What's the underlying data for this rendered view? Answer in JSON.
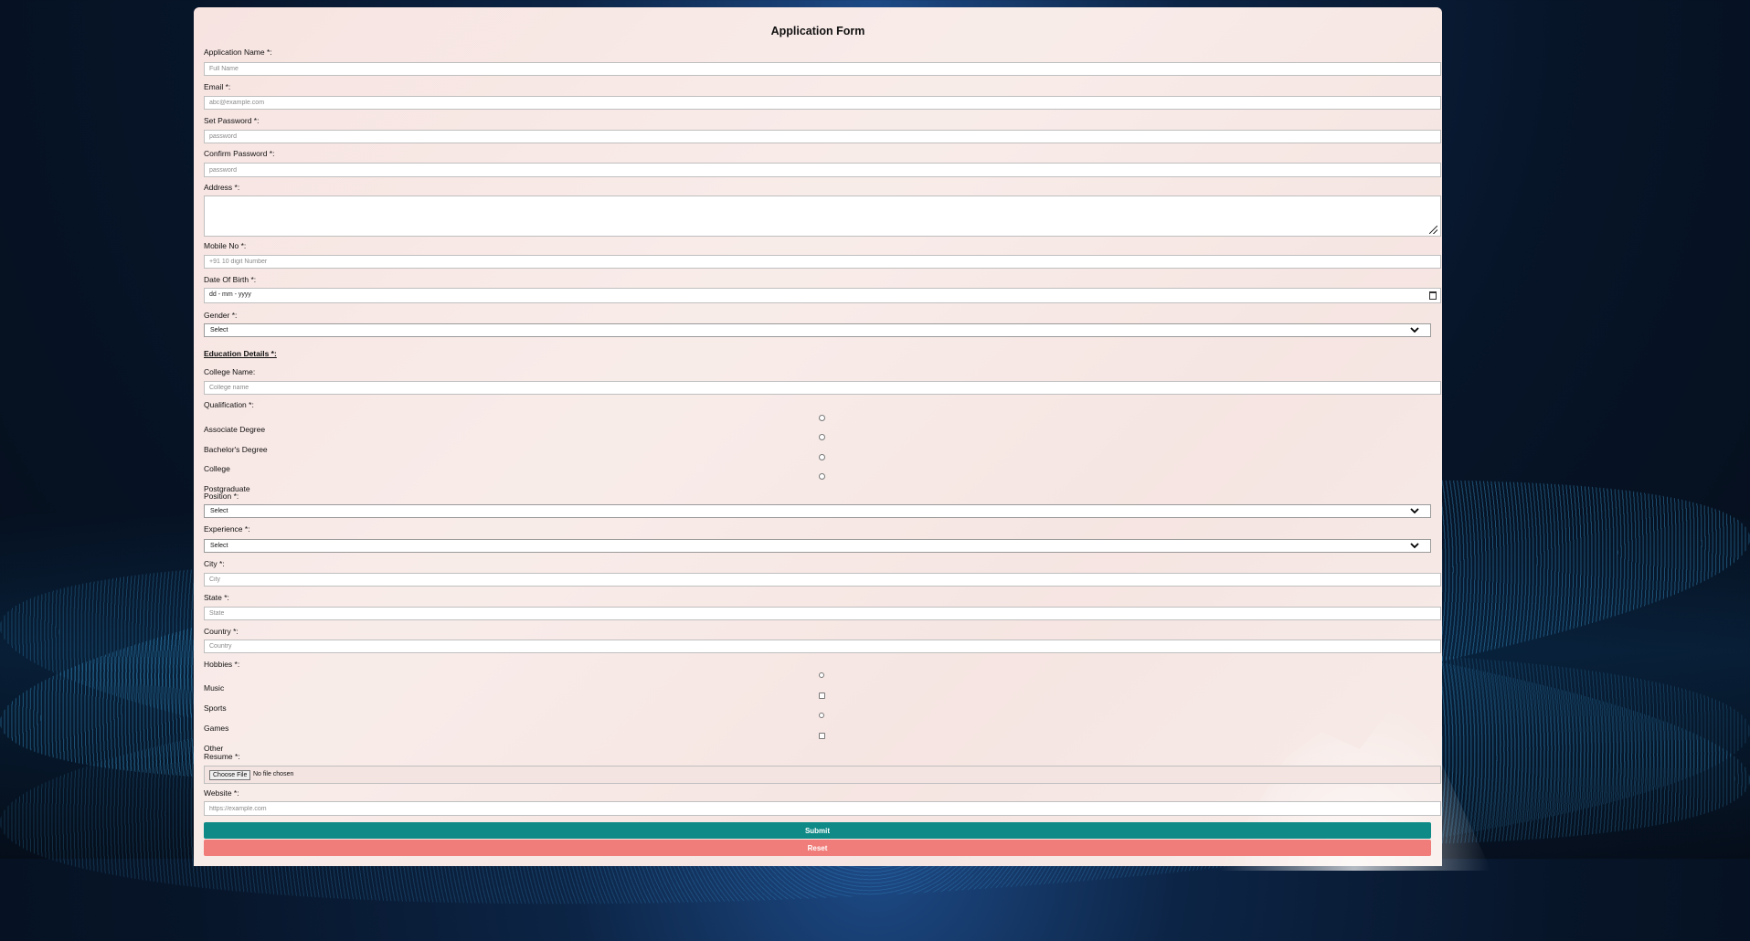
{
  "form": {
    "title": "Application Form",
    "fields": {
      "name": {
        "label": "Application Name *:",
        "placeholder": "Full Name"
      },
      "email": {
        "label": "Email *:",
        "placeholder": "abc@example.com"
      },
      "password": {
        "label": "Set Password *:",
        "placeholder": "password"
      },
      "confirm": {
        "label": "Confirm Password *:",
        "placeholder": "password"
      },
      "address": {
        "label": "Address *:"
      },
      "mobile": {
        "label": "Mobile No *:",
        "placeholder": "+91 10 digit Number"
      },
      "dob": {
        "label": "Date Of Birth *:",
        "value": "dd - mm - yyyy"
      },
      "gender": {
        "label": "Gender *:",
        "value": "Select"
      },
      "education_heading": "Education Details *:",
      "college": {
        "label": "College Name:",
        "placeholder": "College name"
      },
      "qualification": {
        "label": "Qualification *:",
        "options": [
          "Associate Degree",
          "Bachelor's Degree",
          "College",
          "Postgraduate"
        ]
      },
      "position": {
        "label": "Position *:",
        "value": "Select"
      },
      "experience": {
        "label": "Experience *:",
        "value": "Select"
      },
      "city": {
        "label": "City *:",
        "placeholder": "City"
      },
      "state": {
        "label": "State *:",
        "placeholder": "State"
      },
      "country": {
        "label": "Country *:",
        "placeholder": "Country"
      },
      "hobbies": {
        "label": "Hobbies *:",
        "options": [
          "Music",
          "Sports",
          "Games",
          "Other"
        ]
      },
      "resume": {
        "label": "Resume *:",
        "button": "Choose File",
        "status": "No file chosen"
      },
      "website": {
        "label": "Website *:",
        "placeholder": "https://example.com"
      }
    },
    "buttons": {
      "submit": "Submit",
      "reset": "Reset"
    }
  }
}
